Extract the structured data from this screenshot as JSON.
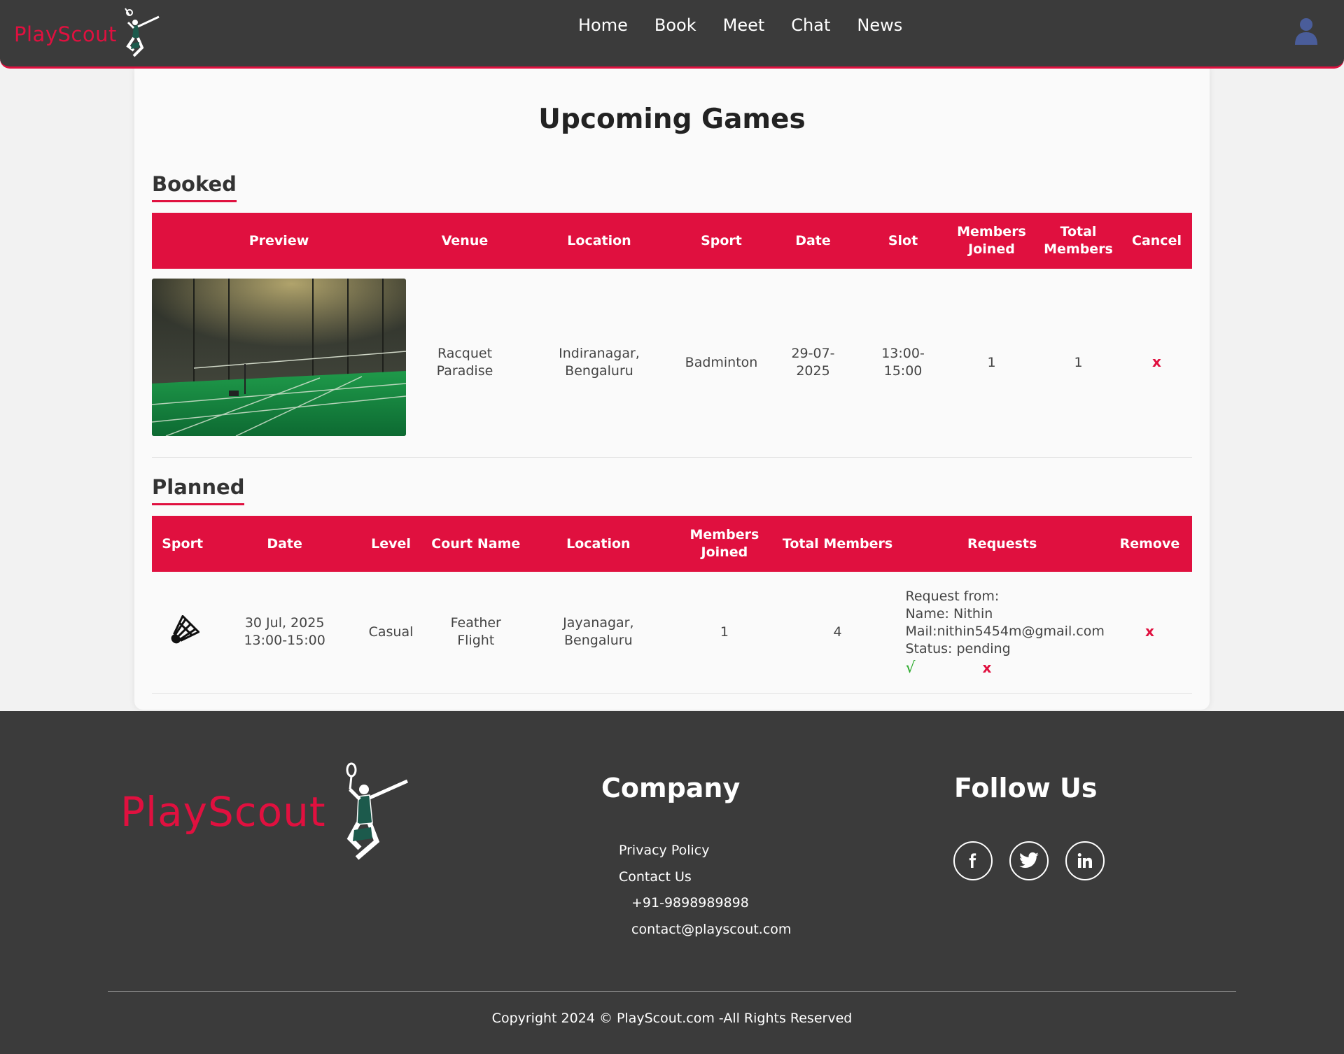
{
  "navbar": {
    "brand": "PlayScout",
    "links": [
      "Home",
      "Book",
      "Meet",
      "Chat",
      "News"
    ]
  },
  "page": {
    "title": "Upcoming Games"
  },
  "booked": {
    "title": "Booked",
    "columns": [
      "Preview",
      "Venue",
      "Location",
      "Sport",
      "Date",
      "Slot",
      "Members Joined",
      "Total Members",
      "Cancel"
    ],
    "rows": [
      {
        "venue": "Racquet Paradise",
        "location": "Indiranagar, Bengaluru",
        "sport": "Badminton",
        "date": "29-07-2025",
        "slot": "13:00-15:00",
        "members_joined": "1",
        "total_members": "1",
        "cancel": "x"
      }
    ]
  },
  "planned": {
    "title": "Planned",
    "columns": [
      "Sport",
      "Date",
      "Level",
      "Court Name",
      "Location",
      "Members Joined",
      "Total Members",
      "Requests",
      "Remove"
    ],
    "rows": [
      {
        "sport_icon": "shuttlecock-icon",
        "date": "30 Jul, 2025 13:00-15:00",
        "level": "Casual",
        "court_name": "Feather Flight",
        "location": "Jayanagar, Bengaluru",
        "members_joined": "1",
        "total_members": "4",
        "request": {
          "line1": "Request from:",
          "name": "Name: Nithin",
          "mail": "Mail:nithin5454m@gmail.com",
          "status": "Status: pending",
          "accept": "√",
          "reject": "x"
        },
        "remove": "x"
      }
    ]
  },
  "footer": {
    "brand": "PlayScout",
    "company_heading": "Company",
    "company_links": [
      "Privacy Policy",
      "Contact Us"
    ],
    "phone": "+91-9898989898",
    "email": "contact@playscout.com",
    "follow_heading": "Follow Us",
    "social": [
      "facebook-icon",
      "twitter-icon",
      "linkedin-icon"
    ],
    "copyright": "Copyright 2024 © PlayScout.com -All Rights Reserved"
  },
  "colors": {
    "accent": "#e0103f",
    "dark": "#3b3b3b",
    "accept": "#2aaa2a"
  }
}
